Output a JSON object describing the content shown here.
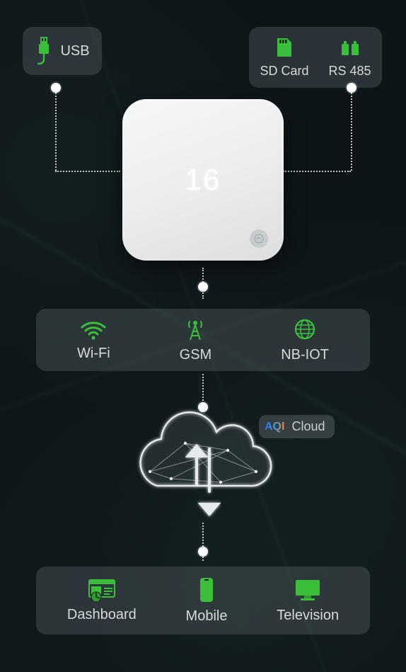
{
  "colors": {
    "accent": "#3bbf3b",
    "text": "#d6dadb"
  },
  "usb": {
    "label": "USB"
  },
  "storage": {
    "sd": {
      "label": "SD Card"
    },
    "rs485": {
      "label": "RS 485"
    }
  },
  "device": {
    "reading": "16"
  },
  "connectivity": {
    "wifi": {
      "label": "Wi-Fi"
    },
    "gsm": {
      "label": "GSM"
    },
    "nbiot": {
      "label": "NB-IOT"
    }
  },
  "cloud": {
    "brand": "AQI",
    "label": "Cloud"
  },
  "outputs": {
    "dashboard": {
      "label": "Dashboard"
    },
    "mobile": {
      "label": "Mobile"
    },
    "television": {
      "label": "Television"
    }
  }
}
